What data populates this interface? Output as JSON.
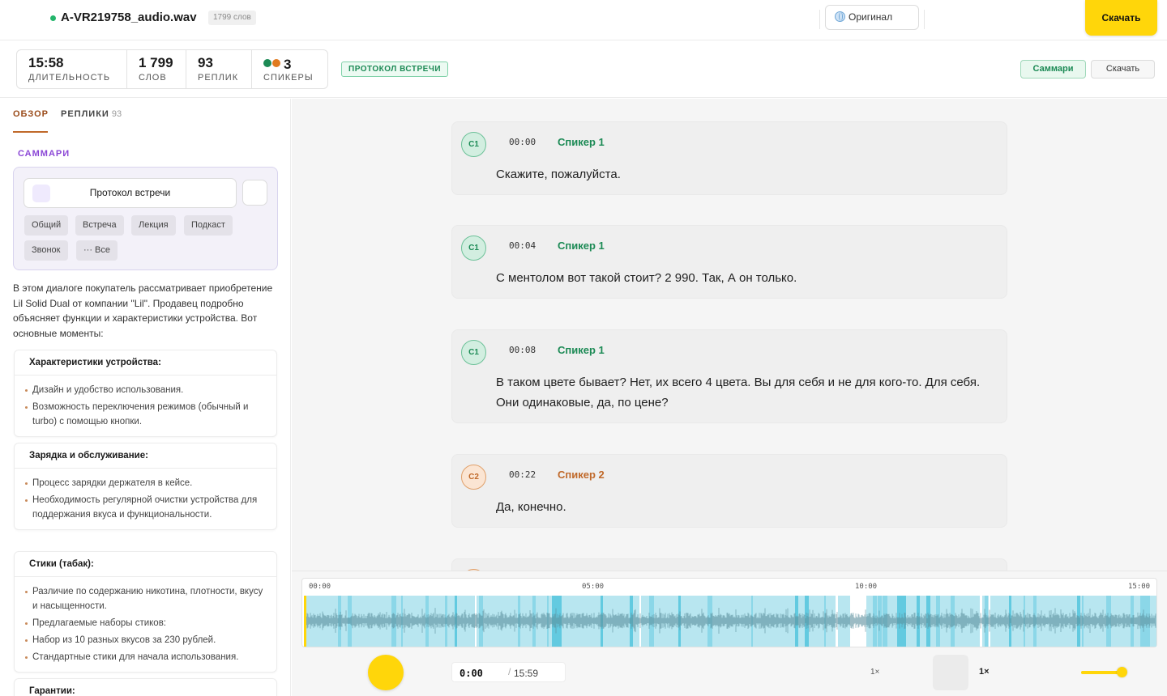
{
  "header": {
    "file_name": "A-VR219758_audio.wav",
    "words_badge": "1799 слов",
    "original_label": "Оригинал",
    "download_label": "Скачать"
  },
  "stats": {
    "duration": {
      "value": "15:58",
      "label": "Длительность"
    },
    "words": {
      "value": "1 799",
      "label": "Слов"
    },
    "replicas": {
      "value": "93",
      "label": "Реплик"
    },
    "speakers": {
      "value": "3",
      "label": "Спикеры"
    },
    "protocol_tag": "ПРОТОКОЛ ВСТРЕЧИ",
    "summary_button": "Саммари",
    "download_button": "Скачать"
  },
  "sidebar": {
    "tab_overview": "Обзор",
    "tab_replicas": "Реплики",
    "tab_replicas_count": "93",
    "summary_label": "САММАРИ",
    "template_select": "Протокол встречи",
    "chips": [
      "Общий",
      "Встреча",
      "Лекция",
      "Подкаст",
      "Звонок",
      "··· Все"
    ],
    "intro": "В этом диалоге покупатель рассматривает приобретение Lil Solid Dual от компании \"Lil\". Продавец подробно объясняет функции и характеристики устройства. Вот основные моменты:",
    "cards": [
      {
        "title": "Характеристики устройства:",
        "items": [
          "Дизайн и удобство использования.",
          "Возможность переключения режимов (обычный и turbo) с помощью кнопки."
        ]
      },
      {
        "title": "Зарядка и обслуживание:",
        "items": [
          "Процесс зарядки держателя в кейсе.",
          "Необходимость регулярной очистки устройства для поддержания вкуса и функциональности."
        ]
      },
      {
        "title": "Стики (табак):",
        "items": [
          "Различие по содержанию никотина, плотности, вкусу и насыщенности.",
          "Предлагаемые наборы стиков:",
          "Набор из 10 разных вкусов за 230 рублей.",
          "Стандартные стики для начала использования."
        ]
      },
      {
        "title": "Гарантии:",
        "items": []
      }
    ]
  },
  "transcript": [
    {
      "avatar": "С1",
      "time": "00:00",
      "speaker": "Спикер 1",
      "text": "Скажите, пожалуйста."
    },
    {
      "avatar": "С1",
      "time": "00:04",
      "speaker": "Спикер 1",
      "text": "С ментолом вот такой стоит? 2 990. Так, А он только."
    },
    {
      "avatar": "С1",
      "time": "00:08",
      "speaker": "Спикер 1",
      "text": "В таком цвете бывает? Нет, их всего 4 цвета. Вы для себя и не для кого-то. Для себя. Они одинаковые, да, по цене?"
    },
    {
      "avatar": "С2",
      "time": "00:22",
      "speaker": "Спикер 2",
      "text": "Да, конечно."
    }
  ],
  "player": {
    "ticks": [
      "00:00",
      "05:00",
      "10:00",
      "15:00"
    ],
    "current_time": "0:00",
    "separator": "/",
    "total_time": "15:59",
    "speed_a": "1×",
    "speed_b": "1×",
    "volume_level": 0.9
  },
  "colors": {
    "accent_yellow": "#ffd60a",
    "speaker1": "#1c8a55",
    "speaker2": "#c0692a",
    "speaker3_dot": "#e07a1f",
    "summary_purple": "#8b47d6",
    "wave_bg": "#b8e6f0",
    "wave_line": "#5a8f9c"
  }
}
